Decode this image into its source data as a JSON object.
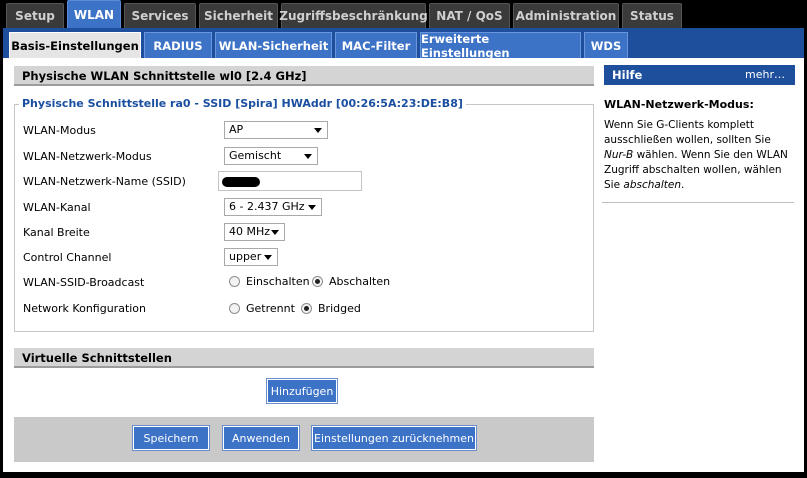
{
  "nav": {
    "top_tabs": [
      "Setup",
      "WLAN",
      "Services",
      "Sicherheit",
      "Zugriffsbeschränkung",
      "NAT / QoS",
      "Administration",
      "Status"
    ],
    "sub_tabs": [
      "Basis-Einstellungen",
      "RADIUS",
      "WLAN-Sicherheit",
      "MAC-Filter",
      "Erweiterte Einstellungen",
      "WDS"
    ],
    "active_top": "WLAN",
    "active_sub": "Basis-Einstellungen"
  },
  "interface": {
    "title": "Physische WLAN Schnittstelle wl0 [2.4 GHz]",
    "legend": "Physische Schnittstelle ra0 - SSID [Spira] HWAddr [00:26:5A:23:DE:B8]",
    "fields": {
      "mode_label": "WLAN-Modus",
      "mode_value": "AP",
      "network_mode_label": "WLAN-Netzwerk-Modus",
      "network_mode_value": "Gemischt",
      "ssid_label": "WLAN-Netzwerk-Name (SSID)",
      "channel_label": "WLAN-Kanal",
      "channel_value": "6 - 2.437 GHz",
      "width_label": "Kanal Breite",
      "width_value": "40 MHz",
      "control_label": "Control Channel",
      "control_value": "upper",
      "broadcast_label": "WLAN-SSID-Broadcast",
      "broadcast_on": "Einschalten",
      "broadcast_off": "Abschalten",
      "netconf_label": "Network Konfiguration",
      "netconf_separate": "Getrennt",
      "netconf_bridged": "Bridged"
    }
  },
  "virtual": {
    "title": "Virtuelle Schnittstellen",
    "add_button": "Hinzufügen"
  },
  "actions": {
    "save": "Speichern",
    "apply": "Anwenden",
    "reset": "Einstellungen zurücknehmen"
  },
  "help": {
    "header": "Hilfe",
    "more": "mehr…",
    "title": "WLAN-Netzwerk-Modus:",
    "text_1": "Wenn Sie G-Clients komplett ausschließen wollen, sollten Sie ",
    "text_em1": "Nur-B",
    "text_2": " wählen. Wenn Sie den WLAN Zugriff abschalten wollen, wählen Sie ",
    "text_em2": "abschalten",
    "text_3": "."
  },
  "colors": {
    "accent": "#3d73c7",
    "nav_dark": "#1e4f9c",
    "legend": "#1a4fa0"
  }
}
